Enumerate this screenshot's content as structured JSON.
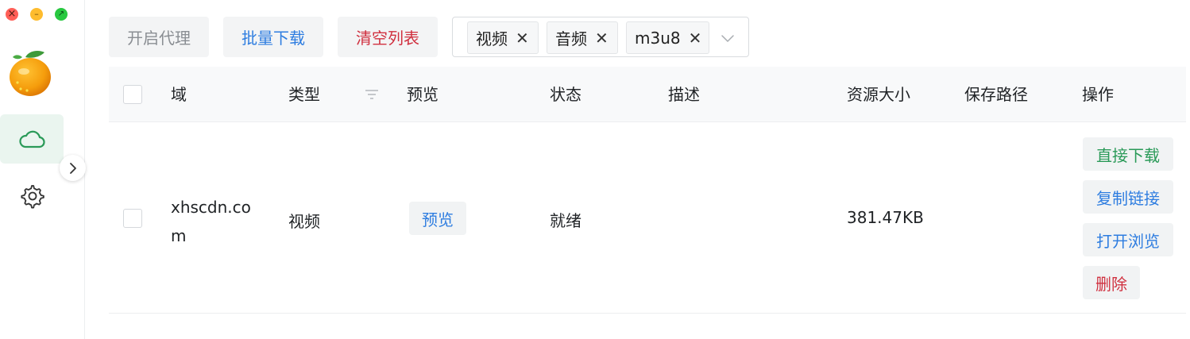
{
  "window": {
    "controls": [
      "close",
      "minimize",
      "maximize"
    ]
  },
  "sidebar": {
    "logo_icon": "orange-fruit-icon",
    "items": [
      {
        "icon": "cloud-icon",
        "active": true
      },
      {
        "icon": "gear-icon",
        "active": false
      }
    ],
    "collapse_icon": "chevron-right-icon"
  },
  "toolbar": {
    "proxy_label": "开启代理",
    "batch_download_label": "批量下载",
    "clear_list_label": "清空列表"
  },
  "type_filter": {
    "tags": [
      "视频",
      "音频",
      "m3u8"
    ],
    "remove_glyph": "✕"
  },
  "table": {
    "columns": [
      "域",
      "类型",
      "预览",
      "状态",
      "描述",
      "资源大小",
      "保存路径",
      "操作"
    ],
    "rows": [
      {
        "domain": "xhscdn.com",
        "type": "视频",
        "preview_label": "预览",
        "status": "就绪",
        "description": "",
        "size": "381.47KB",
        "save_path": "",
        "actions": [
          "直接下载",
          "复制链接",
          "打开浏览",
          "删除"
        ]
      }
    ]
  },
  "colors": {
    "accent_green": "#2a9a58",
    "link_blue": "#2e7de0",
    "danger_red": "#d0303f",
    "active_nav_bg": "#eaf5ef"
  }
}
